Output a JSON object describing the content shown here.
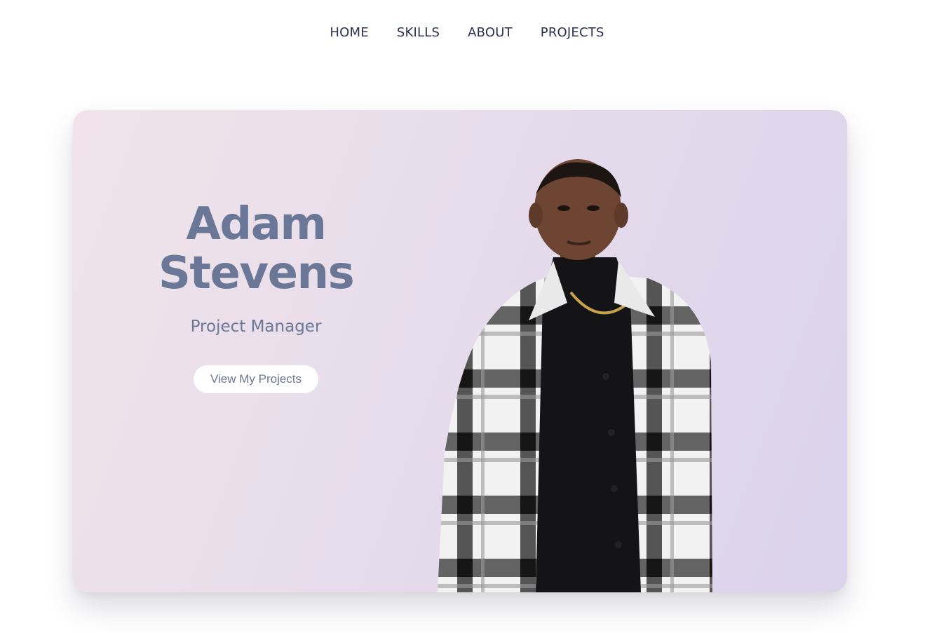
{
  "nav": {
    "items": [
      {
        "label": "HOME"
      },
      {
        "label": "SKILLS"
      },
      {
        "label": "ABOUT"
      },
      {
        "label": "PROJECTS"
      }
    ]
  },
  "hero": {
    "first_name": "Adam",
    "last_name": "Stevens",
    "role": "Project Manager",
    "cta_label": "View My Projects",
    "colors": {
      "name_text": "#6b7796",
      "nav_text": "#2c3050",
      "card_gradient_start": "#f0e4ea",
      "card_gradient_end": "#dbd3ec"
    }
  }
}
